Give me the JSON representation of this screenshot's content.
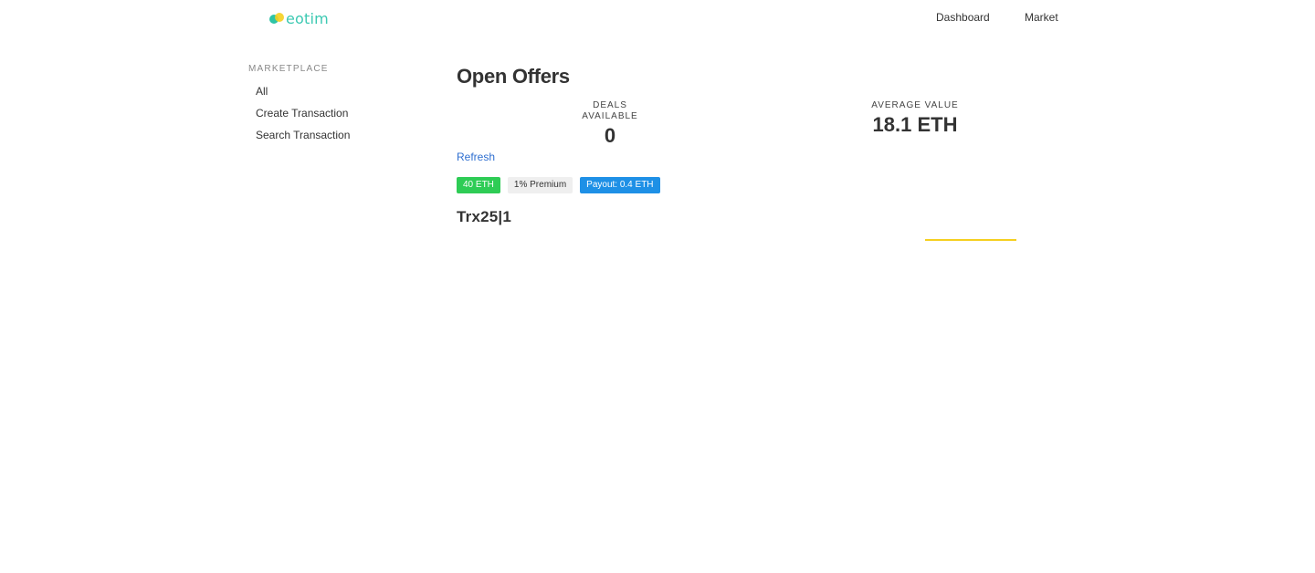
{
  "header": {
    "logo_text": "eotim",
    "nav": {
      "dashboard": "Dashboard",
      "market": "Market"
    }
  },
  "sidebar": {
    "heading": "MARKETPLACE",
    "items": [
      {
        "label": "All"
      },
      {
        "label": "Create Transaction"
      },
      {
        "label": "Search Transaction"
      }
    ]
  },
  "main": {
    "title": "Open Offers",
    "stats": {
      "deals_label": "DEALS AVAILABLE",
      "deals_value": "0",
      "avg_label": "AVERAGE VALUE",
      "avg_value": "18.1 ETH"
    },
    "refresh_label": "Refresh",
    "tags": {
      "amount": "40 ETH",
      "premium": "1% Premium",
      "payout": "Payout: 0.4 ETH"
    },
    "transaction_title": "Trx25|1"
  },
  "colors": {
    "brand": "#3cc9b2",
    "link": "#2f6fd0",
    "tag_amount": "#2ecc55",
    "tag_payout": "#1e90e6",
    "loader": "#f5d020"
  }
}
